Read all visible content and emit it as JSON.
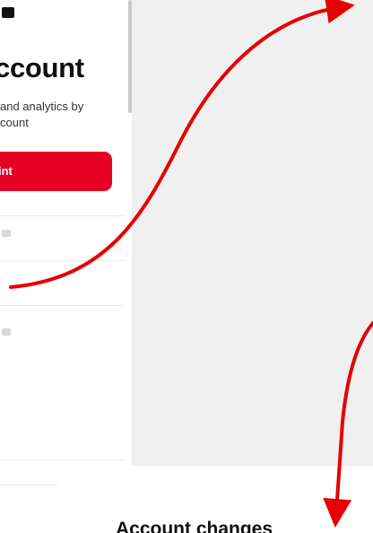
{
  "card": {
    "title": "ccount",
    "description_lines": [
      "and analytics by",
      "count"
    ],
    "primary_button_label": "int"
  },
  "bottom_section": {
    "heading": "Account changes"
  },
  "colors": {
    "primary_button": "#e60023",
    "panel_background": "#f0f0f0",
    "annotation_arrow": "#e60000"
  }
}
